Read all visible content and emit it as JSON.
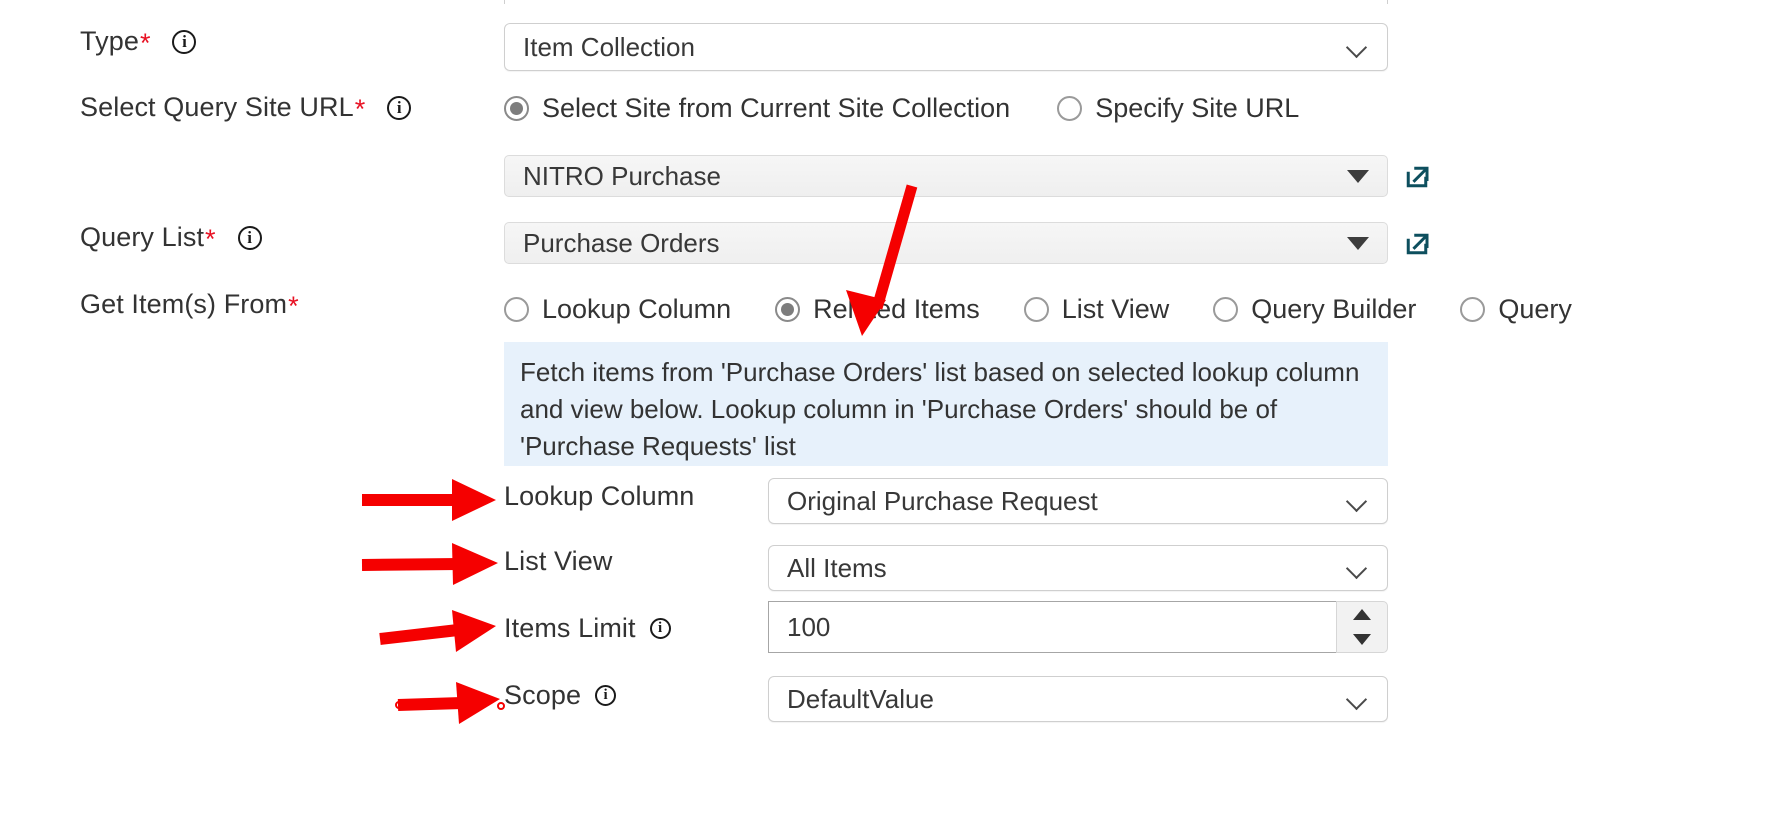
{
  "form": {
    "fields": {
      "type": {
        "label": "Type",
        "required": "*",
        "info_icon": "info-icon",
        "value": "Item Collection"
      },
      "select_query_site_url": {
        "label": "Select Query Site URL",
        "required": "*",
        "info_icon": "info-icon",
        "options": [
          {
            "label": "Select Site from Current Site Collection",
            "checked": true
          },
          {
            "label": "Specify Site URL",
            "checked": false
          }
        ],
        "site_value": "NITRO Purchase",
        "site_open_icon": "external-link-icon"
      },
      "query_list": {
        "label": "Query List",
        "required": "*",
        "info_icon": "info-icon",
        "value": "Purchase Orders",
        "open_icon": "external-link-icon"
      },
      "get_items_from": {
        "label": "Get Item(s) From",
        "required": "*",
        "options": [
          {
            "label": "Lookup Column",
            "checked": false
          },
          {
            "label": "Related Items",
            "checked": true
          },
          {
            "label": "List View",
            "checked": false
          },
          {
            "label": "Query Builder",
            "checked": false
          },
          {
            "label": "Query",
            "checked": false
          }
        ]
      },
      "help_banner": {
        "text": "Fetch items from 'Purchase Orders' list based on selected lookup column and view below. Lookup column in 'Purchase Orders' should be of 'Purchase Requests' list"
      },
      "lookup_column": {
        "label": "Lookup Column",
        "value": "Original Purchase Request"
      },
      "list_view": {
        "label": "List View",
        "value": "All Items"
      },
      "items_limit": {
        "label": "Items Limit",
        "info_icon": "info-icon",
        "value": "100",
        "increment_icon": "triangle-up-icon",
        "decrement_icon": "triangle-down-icon"
      },
      "scope": {
        "label": "Scope",
        "info_icon": "info-icon",
        "value": "DefaultValue"
      }
    }
  },
  "annotations": {
    "arrow_color": "#f50000",
    "arrows": [
      {
        "name": "arrow-to-related-items",
        "target": "Related Items"
      },
      {
        "name": "arrow-to-lookup-column",
        "target": "Lookup Column"
      },
      {
        "name": "arrow-to-list-view",
        "target": "List View"
      },
      {
        "name": "arrow-to-items-limit",
        "target": "Items Limit"
      },
      {
        "name": "arrow-to-scope",
        "target": "Scope"
      }
    ]
  },
  "colors": {
    "required_asterisk": "#e81123",
    "help_banner_bg": "#e7f1fb",
    "external_link_icon": "#0d4f5e",
    "arrow_red": "#f50000"
  }
}
